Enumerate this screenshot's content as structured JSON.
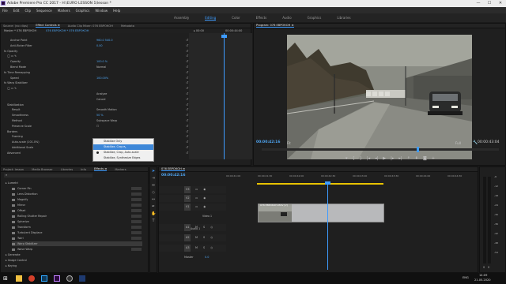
{
  "titlebar": {
    "title": "Adobe Premiere Pro CC 2017 - H:\\EURO LESSON 1\\lesson *",
    "minimize": "—",
    "maximize": "☐",
    "close": "✕"
  },
  "menu": [
    "File",
    "Edit",
    "Clip",
    "Sequence",
    "Markers",
    "Graphics",
    "Window",
    "Help"
  ],
  "workspaces": [
    {
      "label": "Assembly",
      "active": false
    },
    {
      "label": "Editing",
      "active": true
    },
    {
      "label": "Color",
      "active": false
    },
    {
      "label": "Effects",
      "active": false
    },
    {
      "label": "Audio",
      "active": false
    },
    {
      "label": "Graphics",
      "active": false
    },
    {
      "label": "Libraries",
      "active": false
    }
  ],
  "effect_controls": {
    "tabs": [
      {
        "label": "Source: (no clips)",
        "active": false
      },
      {
        "label": "Effect Controls ≡",
        "active": true
      },
      {
        "label": "Audio Clip Mixer: 076 ЕВРОКОН",
        "active": false
      },
      {
        "label": "Metadata",
        "active": false
      }
    ],
    "master_label": "Master * 076 ЕВРОКОН",
    "clip_label": "076 ЕВРОКОН * 076 ЕВРОКОН",
    "ruler_start": "▸ 00:00",
    "ruler_end": "00:00:44:00",
    "rows": [
      {
        "label": "Anchor Point",
        "value": "960.0   540.0",
        "indent": 12,
        "blue": true
      },
      {
        "label": "Anti-flicker Filter",
        "value": "0.00",
        "indent": 12,
        "blue": true
      },
      {
        "label": "fx  Opacity",
        "value": "",
        "indent": 4,
        "blue": false
      },
      {
        "label": "◯  ▭  ✎",
        "value": "",
        "indent": 8,
        "blue": false
      },
      {
        "label": "Opacity",
        "value": "100.0 %",
        "indent": 12,
        "blue": true
      },
      {
        "label": "Blend Mode",
        "value": "Normal",
        "indent": 12,
        "blue": false
      },
      {
        "label": "fx  Time Remapping",
        "value": "",
        "indent": 4,
        "blue": false
      },
      {
        "label": "Speed",
        "value": "100.00%",
        "indent": 12,
        "blue": true
      },
      {
        "label": "fx  Warp Stabilizer",
        "value": "",
        "indent": 4,
        "blue": false
      },
      {
        "label": "◯  ▭  ✎",
        "value": "",
        "indent": 8,
        "blue": false
      },
      {
        "label": "",
        "value": "Analyze",
        "indent": 12,
        "blue": false
      },
      {
        "label": "",
        "value": "Cancel",
        "indent": 12,
        "blue": false
      },
      {
        "label": "Stabilization",
        "value": "",
        "indent": 8,
        "blue": false
      },
      {
        "label": "Result",
        "value": "Smooth Motion",
        "indent": 14,
        "blue": false
      },
      {
        "label": "Smoothness",
        "value": "50 %",
        "indent": 14,
        "blue": true
      },
      {
        "label": "Method",
        "value": "Subspace Warp",
        "indent": 14,
        "blue": false
      },
      {
        "label": "Preserve Scale",
        "value": "☐",
        "indent": 14,
        "blue": false
      },
      {
        "label": "Borders",
        "value": "",
        "indent": 8,
        "blue": false
      },
      {
        "label": "Framing",
        "value": "",
        "indent": 14,
        "blue": false
      },
      {
        "label": "Auto-scale (101.0%)",
        "value": "",
        "indent": 14,
        "blue": false
      },
      {
        "label": "Additional Scale",
        "value": "",
        "indent": 14,
        "blue": false
      },
      {
        "label": "Advanced",
        "value": "",
        "indent": 8,
        "blue": false
      }
    ],
    "framing_current": "Stabilize, Crop, Auto-scale",
    "dropdown": [
      {
        "label": "Stabilize Only",
        "selected": false,
        "checked": false
      },
      {
        "label": "Stabilize, Crop",
        "selected": true,
        "checked": false
      },
      {
        "label": "Stabilize, Crop, Auto-scale",
        "selected": false,
        "checked": true
      },
      {
        "label": "Stabilize, Synthesize Edges",
        "selected": false,
        "checked": false
      }
    ],
    "footer_tc": "00:00:42:16"
  },
  "program": {
    "title": "Program: 076 ЕВРОКОН ≡",
    "timecode_left": "00:00:42:16",
    "fit": "Fit",
    "resolution": "Full",
    "timecode_right": "00:00:43:04"
  },
  "project": {
    "tabs": [
      {
        "label": "Project: lesson",
        "active": false
      },
      {
        "label": "Media Browser",
        "active": false
      },
      {
        "label": "Libraries",
        "active": false
      },
      {
        "label": "Info",
        "active": false
      },
      {
        "label": "Effects ≡",
        "active": true
      },
      {
        "label": "Markers",
        "active": false
      }
    ],
    "items": [
      {
        "label": "Lumetri",
        "indent": 6,
        "folder": true
      },
      {
        "label": "Corner Pin",
        "indent": 14,
        "folder": false,
        "selected": false
      },
      {
        "label": "Lens Distortion",
        "indent": 14,
        "folder": false,
        "selected": false
      },
      {
        "label": "Magnify",
        "indent": 14,
        "folder": false,
        "selected": false
      },
      {
        "label": "Mirror",
        "indent": 14,
        "folder": false,
        "selected": false
      },
      {
        "label": "Offset",
        "indent": 14,
        "folder": false,
        "selected": false
      },
      {
        "label": "Rolling Shutter Repair",
        "indent": 14,
        "folder": false,
        "selected": false
      },
      {
        "label": "Spherize",
        "indent": 14,
        "folder": false,
        "selected": false
      },
      {
        "label": "Transform",
        "indent": 14,
        "folder": false,
        "selected": false
      },
      {
        "label": "Turbulent Displace",
        "indent": 14,
        "folder": false,
        "selected": false
      },
      {
        "label": "Twirl",
        "indent": 14,
        "folder": false,
        "selected": false
      },
      {
        "label": "Warp Stabilizer",
        "indent": 14,
        "folder": false,
        "selected": true
      },
      {
        "label": "Wave Warp",
        "indent": 14,
        "folder": false,
        "selected": false
      },
      {
        "label": "Generate",
        "indent": 6,
        "folder": true
      },
      {
        "label": "Image Control",
        "indent": 6,
        "folder": true
      },
      {
        "label": "Keying",
        "indent": 6,
        "folder": true
      }
    ]
  },
  "timeline": {
    "title": "076 ЕВРОКОН ≡",
    "timecode": "00:00:42:16",
    "ruler": [
      "00:00:41:00",
      "00:00:41:30",
      "00:00:42:00",
      "00:00:42:30",
      "00:00:43:00",
      "00:00:43:30",
      "00:00:44:00",
      "00:00:44:30"
    ],
    "video_tracks": [
      "V3",
      "V2",
      "V1"
    ],
    "video1_name": "Video 1",
    "audio_tracks": [
      "A1",
      "A2",
      "A3"
    ],
    "audio1_name": "Audio 1",
    "master_label": "Master",
    "master_value": "0.0",
    "clip_label": "076 ЕВРОКОН.MOV [V]"
  },
  "meters": {
    "ticks": [
      "-6",
      "-12",
      "-18",
      "-24",
      "-30",
      "-36",
      "-42",
      "-48",
      "-54"
    ],
    "solo": [
      "S",
      "S"
    ]
  },
  "taskbar": {
    "lang": "ENG",
    "time": "14:09",
    "date": "21.05.2020"
  }
}
